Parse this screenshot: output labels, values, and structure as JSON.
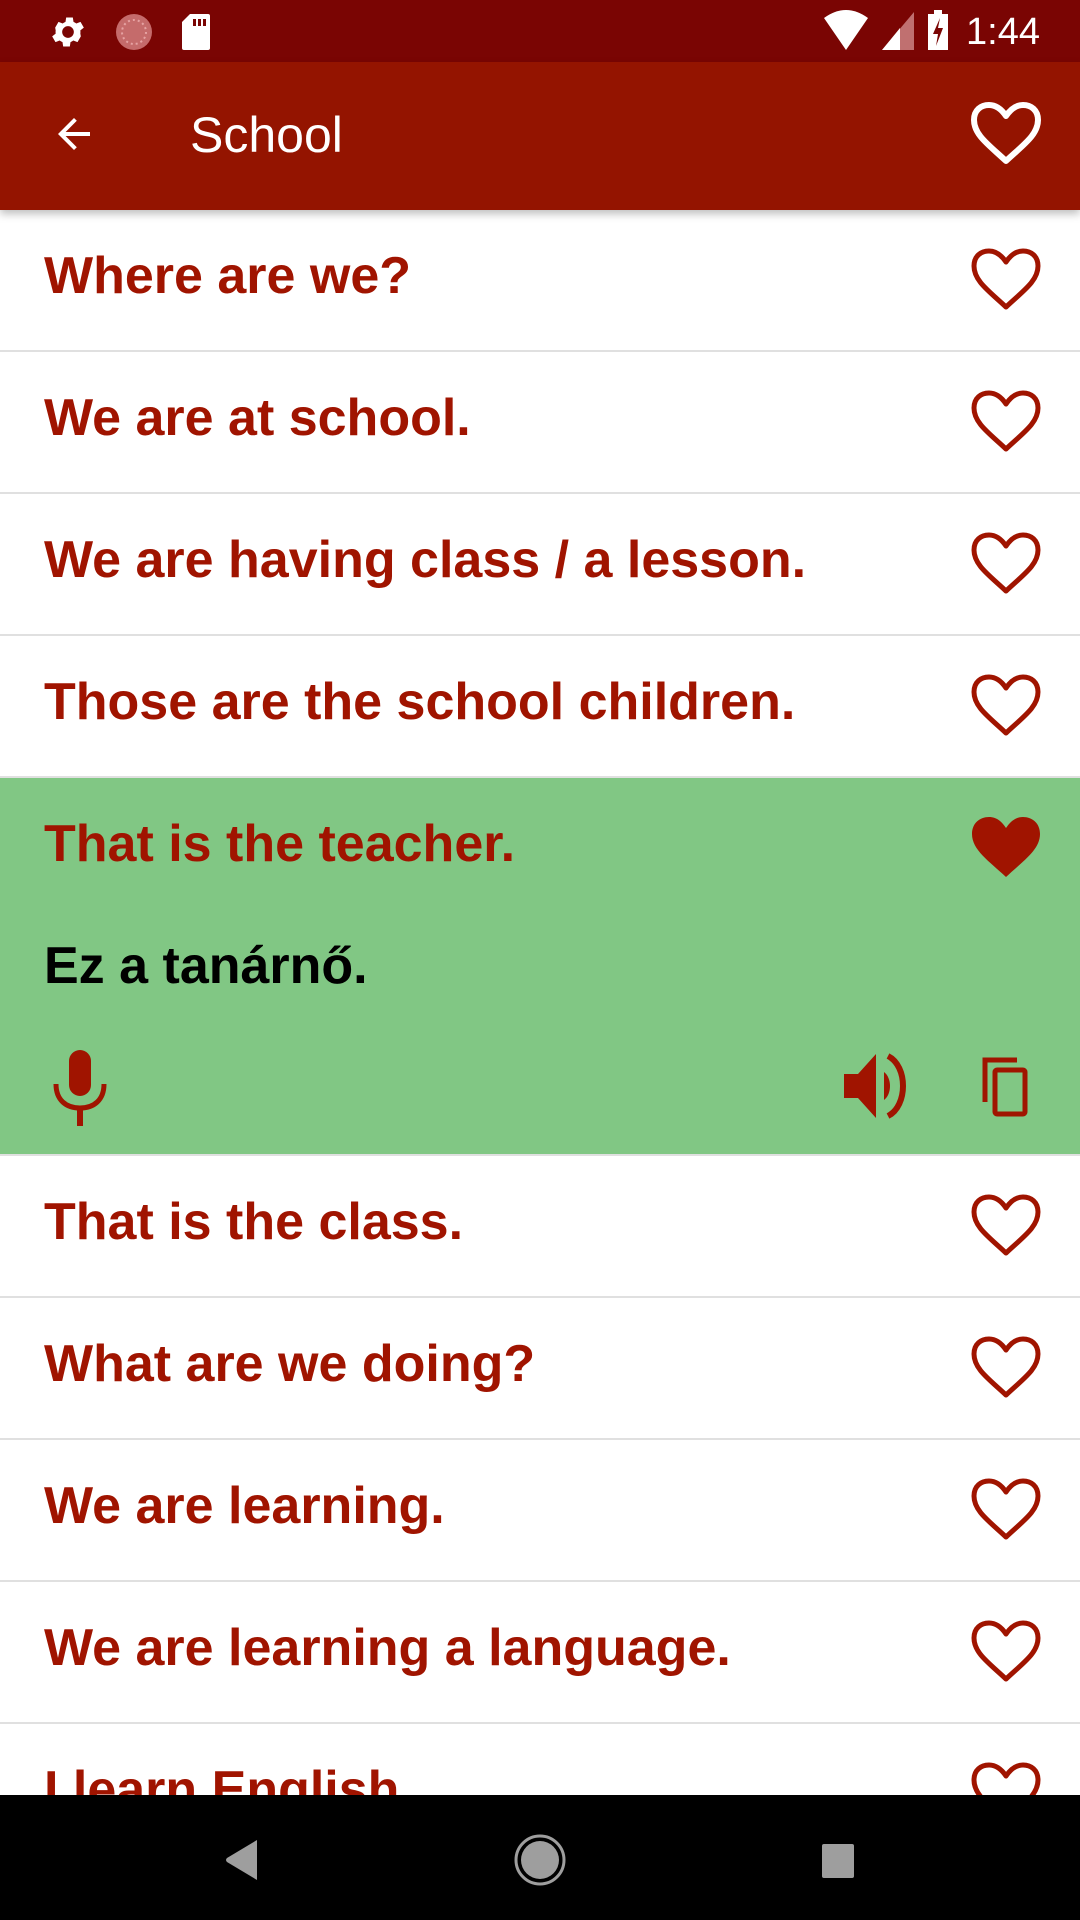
{
  "status_bar": {
    "time": "1:44",
    "left_icons": [
      "settings-icon",
      "sync-progress-icon",
      "sd-card-icon"
    ],
    "right_icons": [
      "wifi-icon",
      "cell-signal-icon",
      "battery-charging-icon"
    ]
  },
  "app_bar": {
    "title": "School",
    "back_icon": "arrow-back-icon",
    "favorite_icon": "heart-outline-icon"
  },
  "colors": {
    "status_bar": "#7a0503",
    "app_bar": "#941400",
    "phrase_text": "#a01400",
    "expanded_bg": "#81c784",
    "divider": "#e0e0e0"
  },
  "phrases": [
    {
      "text": "Where are we?",
      "favorite": false
    },
    {
      "text": "We are at school.",
      "favorite": false
    },
    {
      "text": "We are having class / a lesson.",
      "favorite": false
    },
    {
      "text": "Those are the school children.",
      "favorite": false
    },
    {
      "text": "That is the teacher.",
      "favorite": true,
      "expanded": true,
      "translation": "Ez a tanárnő."
    },
    {
      "text": "That is the class.",
      "favorite": false
    },
    {
      "text": "What are we doing?",
      "favorite": false
    },
    {
      "text": "We are learning.",
      "favorite": false
    },
    {
      "text": "We are learning a language.",
      "favorite": false
    },
    {
      "text": "I learn English.",
      "favorite": false
    }
  ],
  "expanded_actions": [
    "microphone-icon",
    "speaker-icon",
    "copy-icon"
  ],
  "nav_bar": [
    "back-triangle-icon",
    "home-circle-icon",
    "recents-square-icon"
  ]
}
